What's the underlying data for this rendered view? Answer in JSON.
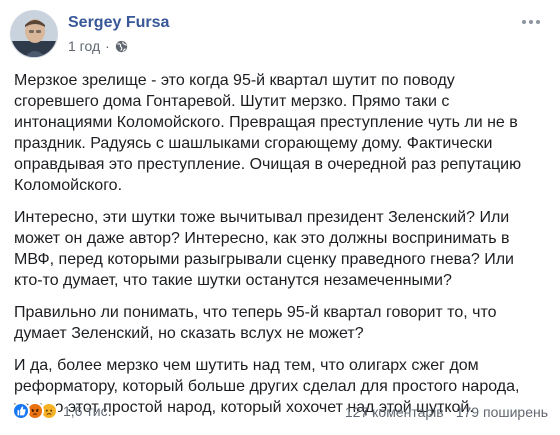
{
  "post": {
    "author": "Sergey Fursa",
    "time": "1 год",
    "separator": "·",
    "paragraphs": [
      "Мерзкое зрелище - это когда 95-й квартал шутит по поводу сгоревшего дома Гонтаревой. Шутит мерзко. Прямо таки с интонациями Коломойского. Превращая преступление чуть ли не в праздник. Радуясь с шашлыками сгорающему дому. Фактически оправдывая это преступление. Очищая в очередной раз репутацию Коломойского.",
      "Интересно, эти шутки тоже вычитывал президент Зеленский? Или может он даже автор? Интересно, как это должны воспринимать в МВФ, перед которыми разыгрывали сценку праведного гнева? Или кто-то думает, что такие шутки останутся незамеченными?",
      "Правильно ли понимать, что теперь 95-й квартал говорит то, что думает Зеленский, но сказать вслух не может?",
      "И да, более мерзко чем шутить над тем, что олигарх сжег дом реформатору, который больше других сделал для простого народа, только этот простой народ, который хохочет над этой шуткой."
    ]
  },
  "footer": {
    "reaction_icons": [
      "like-icon",
      "angry-icon",
      "sad-icon"
    ],
    "reaction_count": "1,6 тис.",
    "comments": "127 коментарів",
    "shares": "179 поширень"
  },
  "colors": {
    "author_link": "#385898",
    "meta_text": "#606770",
    "like_blue": "#1877f2",
    "angry_orange": "#e9710f",
    "sad_yellow": "#f7b125"
  }
}
